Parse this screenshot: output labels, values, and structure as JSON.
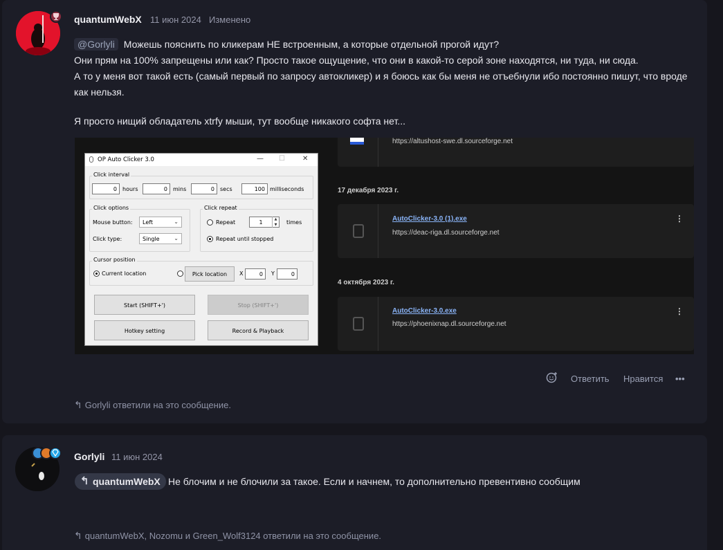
{
  "post1": {
    "author": "quantumWebX",
    "date": "11 июн 2024",
    "edited": "Изменено",
    "mention": "@Gorlyli",
    "lines": [
      "Можешь пояснить по кликерам НЕ встроенным, а которые отдельной прогой идут?",
      "Они прям на 100% запрещены или как? Просто такое ощущение, что они в какой-то серой зоне находятся, ни туда, ни сюда.",
      "А то у меня вот такой есть (самый первый по запросу автокликер) и я боюсь как бы меня не отъебнули ибо постоянно пишут, что вроде",
      "как нельзя."
    ],
    "line_last": "Я просто нищий обладатель xtrfy мыши, тут вообще никакого софта нет...",
    "actions": {
      "reply": "Ответить",
      "like": "Нравится",
      "more": "•••"
    },
    "replies_note": "Gorlyli ответили на это сообщение.",
    "reaction_icon": "smiley-add-icon"
  },
  "embed": {
    "downloads": [
      {
        "url": "https://altushost-swe.dl.sourceforge.net"
      },
      {
        "date": "17 декабря 2023 г.",
        "name": "AutoClicker-3.0 (1).exe",
        "url": "https://deac-riga.dl.sourceforge.net"
      },
      {
        "date": "4 октября 2023 г.",
        "name": "AutoClicker-3.0.exe",
        "url": "https://phoenixnap.dl.sourceforge.net"
      }
    ],
    "window": {
      "title": "OP Auto Clicker 3.0",
      "click_interval": "Click interval",
      "hours_val": "0",
      "hours": "hours",
      "mins_val": "0",
      "mins": "mins",
      "secs_val": "0",
      "secs": "secs",
      "ms_val": "100",
      "ms": "milliseconds",
      "click_options": "Click options",
      "mouse_button": "Mouse button:",
      "mouse_button_val": "Left",
      "click_type": "Click type:",
      "click_type_val": "Single",
      "click_repeat": "Click repeat",
      "repeat": "Repeat",
      "repeat_val": "1",
      "times": "times",
      "repeat_until": "Repeat until stopped",
      "cursor_position": "Cursor position",
      "current_location": "Current location",
      "pick_location": "Pick location",
      "x_label": "X",
      "x_val": "0",
      "y_label": "Y",
      "y_val": "0",
      "start": "Start (SHIFT+')",
      "stop": "Stop (SHIFT+')",
      "hotkey": "Hotkey setting",
      "record": "Record & Playback"
    }
  },
  "post2": {
    "author": "Gorlyli",
    "date": "11 июн 2024",
    "quote_author": "quantumWebX",
    "text": "Не блочим и не блочили за такое. Если и начнем, то дополнительно превентивно сообщим",
    "replies_note": "quantumWebX, Nozomu и Green_Wolf3124 ответили на это сообщение."
  }
}
